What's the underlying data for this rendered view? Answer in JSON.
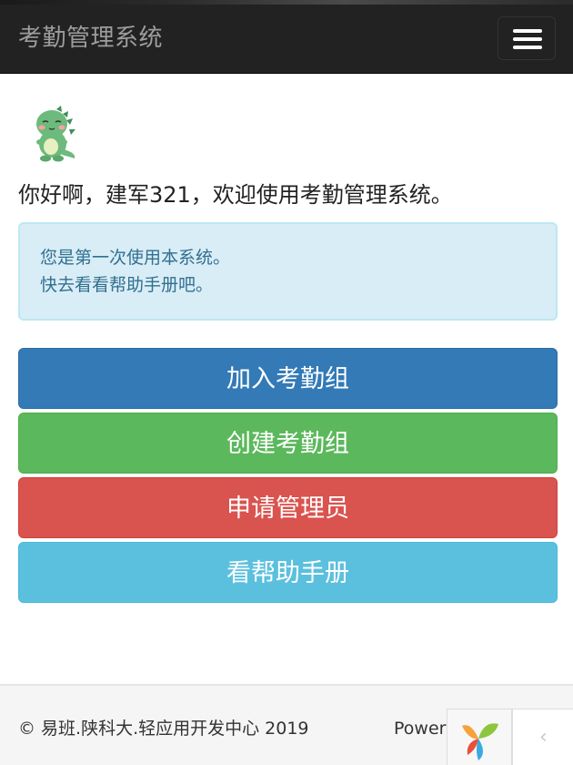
{
  "navbar": {
    "brand": "考勤管理系统",
    "menu_icon": "hamburger-menu-icon"
  },
  "avatar": {
    "icon": "dinosaur-avatar-icon"
  },
  "greeting": "你好啊，建军321，欢迎使用考勤管理系统。",
  "alert": {
    "line1": "您是第一次使用本系统。",
    "line2": "快去看看帮助手册吧。"
  },
  "buttons": {
    "join_group": "加入考勤组",
    "create_group": "创建考勤组",
    "apply_admin": "申请管理员",
    "help_manual": "看帮助手册"
  },
  "footer": {
    "copyright": "© 易班.陕科大.轻应用开发中心 2019",
    "powered": "Powered by",
    "debug_logo_icon": "yii-logo-icon",
    "collapse_icon": "chevron-left-icon"
  },
  "colors": {
    "navbar_bg": "#222222",
    "brand_text": "#9d9d9d",
    "alert_bg": "#d9edf7",
    "alert_text": "#31708f",
    "primary": "#337ab7",
    "success": "#5cb85c",
    "danger": "#d9534f",
    "info": "#5bc0de",
    "footer_bg": "#f5f5f5"
  }
}
